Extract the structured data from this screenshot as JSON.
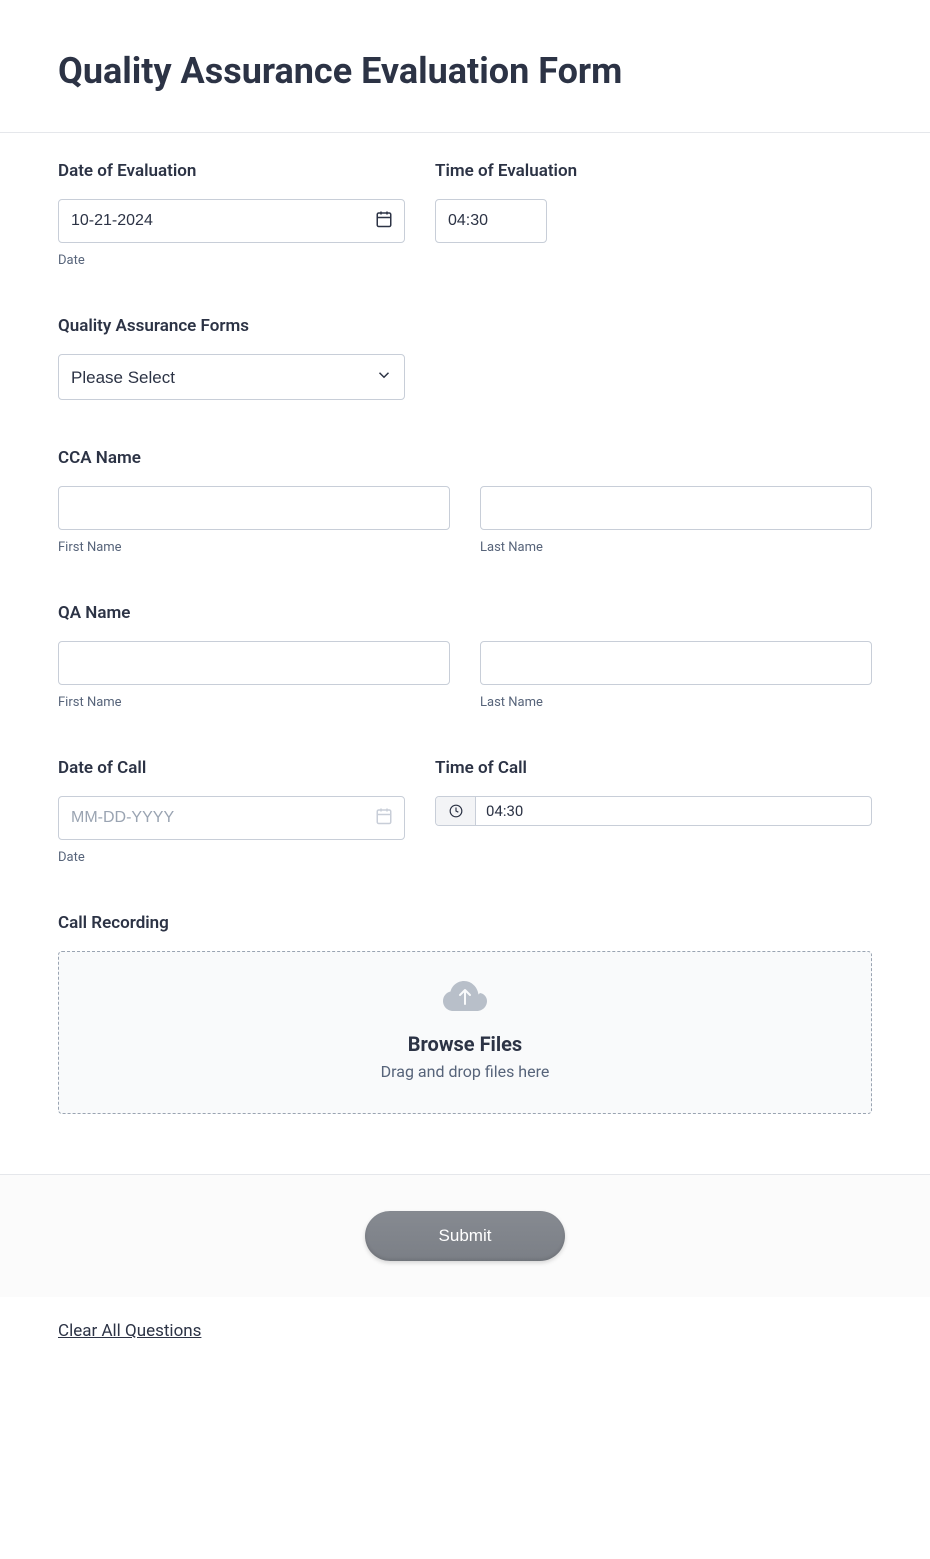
{
  "header": {
    "title": "Quality Assurance Evaluation Form"
  },
  "fields": {
    "dateEval": {
      "label": "Date of Evaluation",
      "value": "10-21-2024",
      "sublabel": "Date"
    },
    "timeEval": {
      "label": "Time of Evaluation",
      "value": "04:30"
    },
    "qaForms": {
      "label": "Quality Assurance Forms",
      "selected": "Please Select"
    },
    "ccaName": {
      "label": "CCA Name",
      "firstSublabel": "First Name",
      "lastSublabel": "Last Name"
    },
    "qaName": {
      "label": "QA Name",
      "firstSublabel": "First Name",
      "lastSublabel": "Last Name"
    },
    "dateCall": {
      "label": "Date of Call",
      "placeholder": "MM-DD-YYYY",
      "sublabel": "Date"
    },
    "timeCall": {
      "label": "Time of Call",
      "value": "04:30"
    },
    "recording": {
      "label": "Call Recording",
      "browse": "Browse Files",
      "dragText": "Drag and drop files here"
    }
  },
  "footer": {
    "submit": "Submit",
    "clear": "Clear All Questions"
  }
}
